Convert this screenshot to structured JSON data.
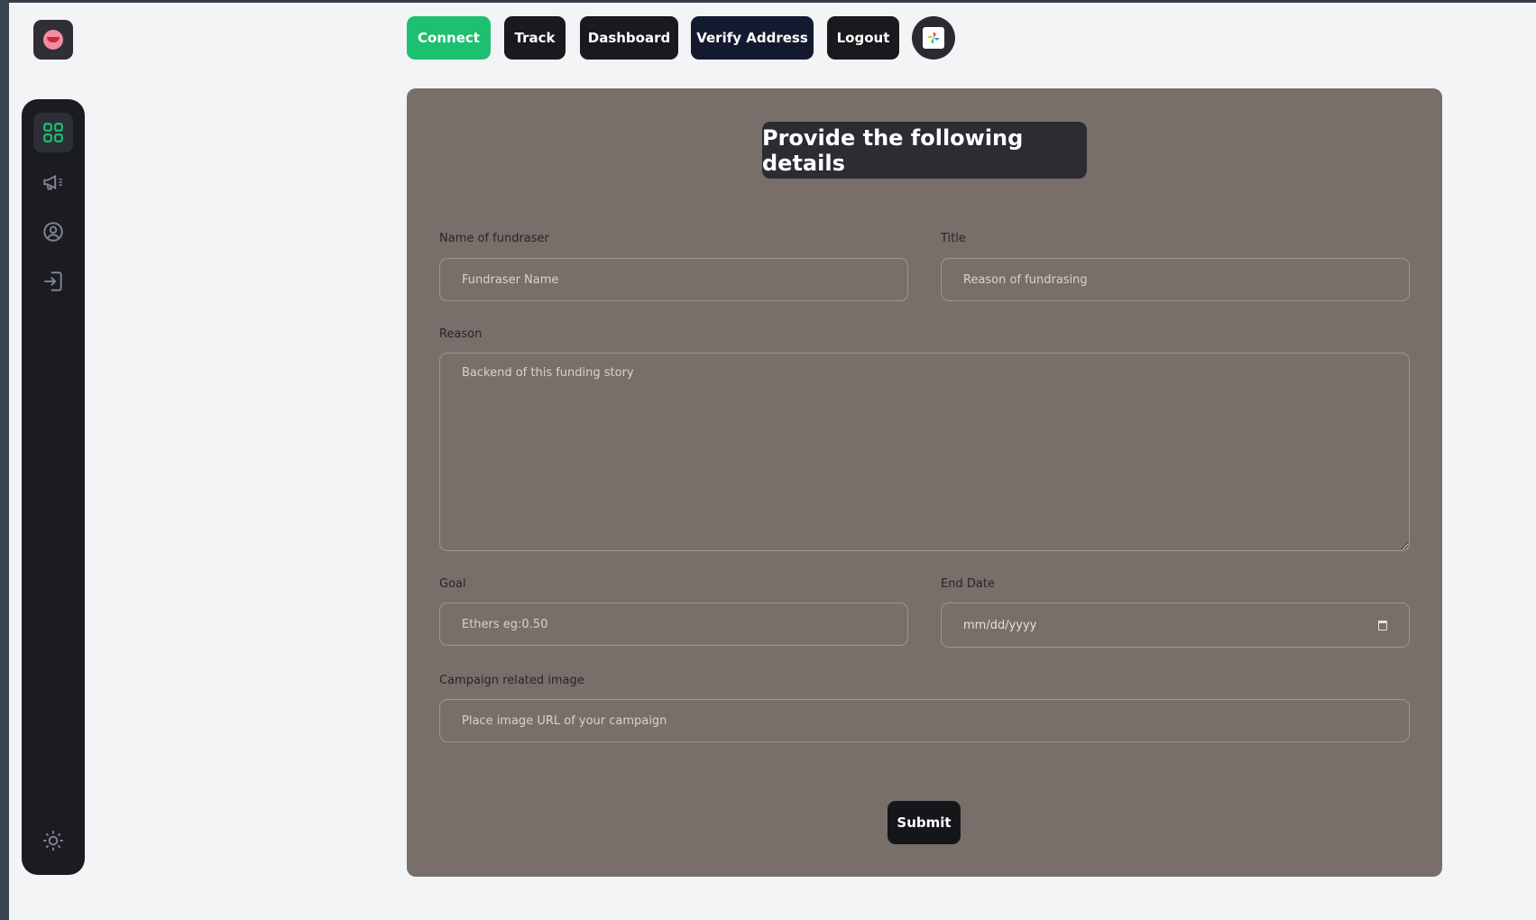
{
  "nav": {
    "connect_label": "Connect",
    "track_label": "Track",
    "dashboard_label": "Dashboard",
    "verify_label": "Verify Address",
    "logout_label": "Logout"
  },
  "sidebar": {
    "items": [
      {
        "icon": "grid-icon",
        "active": true
      },
      {
        "icon": "megaphone-icon",
        "active": false
      },
      {
        "icon": "user-circle-icon",
        "active": false
      },
      {
        "icon": "login-icon",
        "active": false
      }
    ],
    "bottom_icon": "sun-icon"
  },
  "form": {
    "title": "Provide the following details",
    "name_label": "Name of fundraser",
    "name_placeholder": "Fundraser Name",
    "title_label": "Title",
    "title_placeholder": "Reason of fundrasing",
    "reason_label": "Reason",
    "reason_placeholder": "Backend of this funding story",
    "goal_label": "Goal",
    "goal_placeholder": "Ethers eg:0.50",
    "end_date_label": "End Date",
    "end_date_placeholder": "mm/dd/yyyy",
    "image_label": "Campaign related image",
    "image_placeholder": "Place image URL of your campaign",
    "submit_label": "Submit"
  },
  "colors": {
    "accent": "#1dc071",
    "panel": "#786f6a",
    "sidebar": "#1b1c22"
  }
}
